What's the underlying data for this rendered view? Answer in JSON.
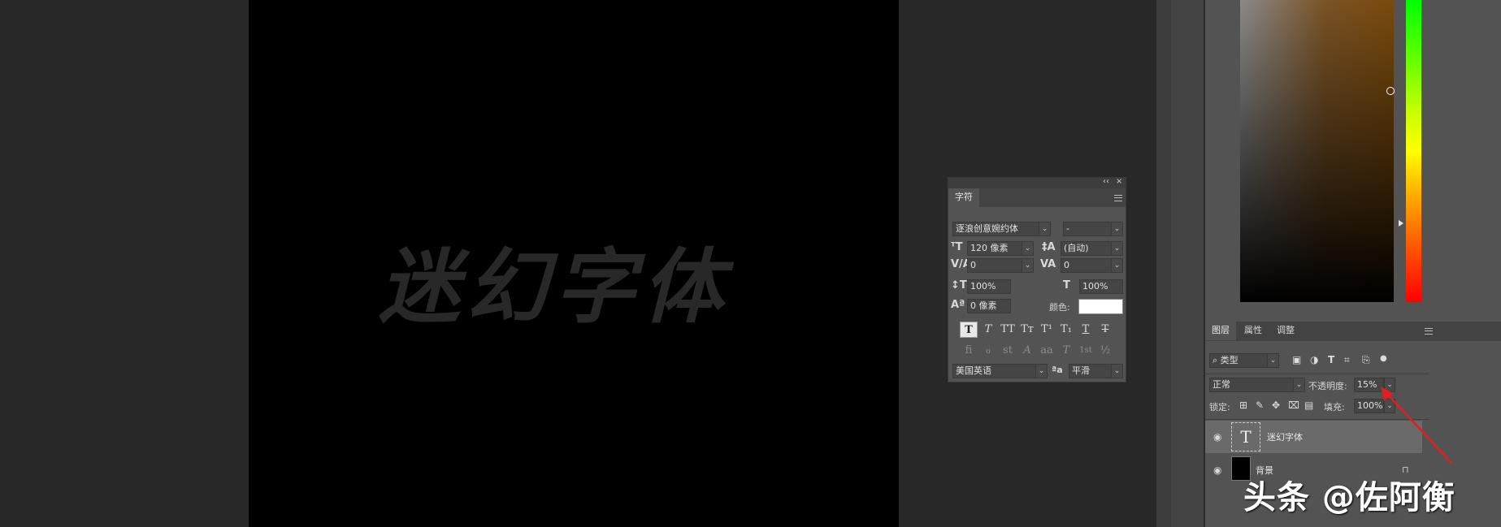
{
  "canvas": {
    "text": "迷幻字体"
  },
  "character_panel": {
    "collapse_glyph": "‹‹",
    "close_glyph": "×",
    "tab": "字符",
    "font_family": "逐浪创意婉约体",
    "font_style": "-",
    "font_size": "120 像素",
    "leading": "(自动)",
    "kerning": "0",
    "tracking": "0",
    "vertical_scale": "100%",
    "horizontal_scale": "100%",
    "baseline_shift": "0 像素",
    "color_label": "颜色:",
    "color_value": "#ffffff",
    "style_buttons": [
      "T",
      "T",
      "TT",
      "Tт",
      "T¹",
      "T₁",
      "T",
      "T"
    ],
    "opentype_buttons": [
      "fi",
      "ℴ",
      "st",
      "A",
      "aa",
      "T",
      "1st",
      "½"
    ],
    "language": "美国英语",
    "aa_icon": "ªa",
    "antialias": "平滑"
  },
  "layers_panel": {
    "tabs": [
      "图层",
      "属性",
      "调整"
    ],
    "filter_kind": "类型",
    "blend_mode": "正常",
    "opacity_label": "不透明度:",
    "opacity_value": "15%",
    "lock_label": "锁定:",
    "fill_label": "填充:",
    "fill_value": "100%",
    "layers": [
      {
        "name": "迷幻字体",
        "type_glyph": "T",
        "selected": true
      },
      {
        "name": "背景",
        "selected": false
      }
    ]
  },
  "watermark": "头条 @佐阿衡",
  "colors": {
    "workspace": "#282828",
    "canvas": "#000000",
    "panel": "#535353",
    "arrow": "#e02020"
  }
}
